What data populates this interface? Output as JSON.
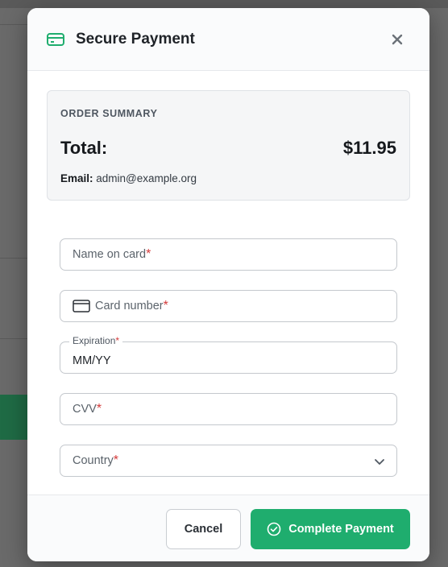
{
  "modal": {
    "title": "Secure Payment",
    "header_icon": "credit-card-icon",
    "close_icon": "close-icon"
  },
  "summary": {
    "label": "ORDER SUMMARY",
    "total_label": "Total:",
    "total_value": "$11.95",
    "email_label": "Email:",
    "email_value": "admin@example.org"
  },
  "form": {
    "name_placeholder": "Name on card",
    "card_placeholder": "Card number",
    "card_icon": "credit-card-icon",
    "expiration_label": "Expiration",
    "expiration_value": "MM/YY",
    "cvv_placeholder": "CVV",
    "country_placeholder": "Country",
    "required_marker": "*"
  },
  "footer": {
    "cancel_label": "Cancel",
    "pay_label": "Complete Payment",
    "pay_icon": "check-circle-icon"
  },
  "colors": {
    "accent": "#1fad6e",
    "required": "#d43a3a"
  }
}
